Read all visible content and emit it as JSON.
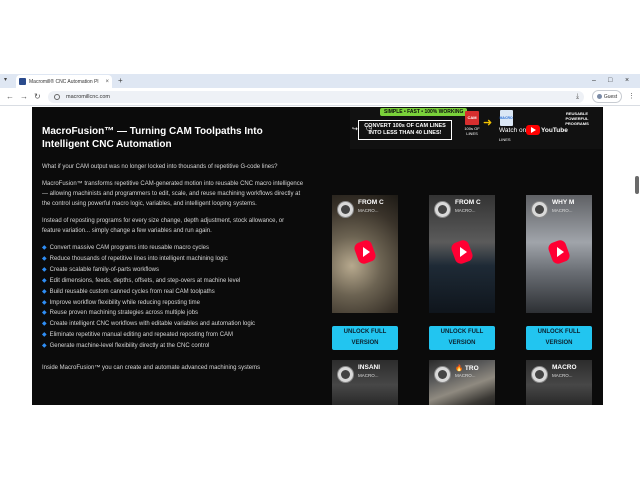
{
  "browser": {
    "tab_title": "Macromill® CNC Automation Pl",
    "tab_close": "×",
    "new_tab": "+",
    "tab_menu": "▾",
    "url": "macromillcnc.com",
    "guest_label": "Guest",
    "win_min": "–",
    "win_max": "□",
    "win_close": "×",
    "back": "←",
    "forward": "→",
    "reload": "↻",
    "download": "⤓",
    "menu": "⋮"
  },
  "article": {
    "headline": "MacroFusion™ — Turning CAM Toolpaths Into Intelligent CNC Automation",
    "para1": "What if your CAM output was no longer locked into thousands of repetitive G-code lines?",
    "para2": "MacroFusion™ transforms repetitive CAM-generated motion into reusable CNC macro intelligence — allowing machinists and programmers to edit, scale, and reuse machining workflows directly at the control using powerful macro logic, variables, and intelligent looping systems.",
    "para3": "Instead of reposting programs for every size change, depth adjustment, stock allowance, or feature variation... simply change a few variables and run again.",
    "features": [
      "Convert massive CAM programs into reusable macro cycles",
      "Reduce thousands of repetitive lines into intelligent machining logic",
      "Create scalable family-of-parts workflows",
      "Edit dimensions, feeds, depths, offsets, and step-overs at machine level",
      "Build reusable custom canned cycles from real CAM toolpaths",
      "Improve workflow flexibility while reducing reposting time",
      "Reuse proven machining strategies across multiple jobs",
      "Create intelligent CNC workflows with editable variables and automation logic",
      "Eliminate repetitive manual editing and repeated reposting from CAM",
      "Generate machine-level flexibility directly at the CNC control"
    ],
    "bullet": "◆",
    "cut_line": "Inside MacroFusion™ you can create and automate advanced machining systems"
  },
  "banner": {
    "tag": "SIMPLE • FAST • 100% WORKING",
    "line1": "CONVERT 100s OF CAM LINES",
    "line2": "INTO LESS THAN 40 LINES!",
    "cam_label": "CAM",
    "cam_caption": "100s OF LINES",
    "file_label": "MACRO",
    "file_caption": "LINES",
    "watch_on": "Watch on",
    "youtube": "YouTube",
    "reusable": "REUSABLE POWERFUL PROGRAMS",
    "share": "↪",
    "clock": "◷"
  },
  "cards": [
    {
      "title": "FROM C",
      "sub": "MACRO...",
      "button": "UNLOCK FULL VERSION"
    },
    {
      "title": "FROM C",
      "sub": "MACRO...",
      "button": "UNLOCK FULL VERSION"
    },
    {
      "title": "WHY M",
      "sub": "MACRO...",
      "button": "UNLOCK FULL VERSION"
    }
  ],
  "cards_lower": [
    {
      "title": "INSANI",
      "sub": "MACRO..."
    },
    {
      "title": "🔥 TRO",
      "sub": "MACRO..."
    },
    {
      "title": "MACRO",
      "sub": "MACRO..."
    }
  ]
}
